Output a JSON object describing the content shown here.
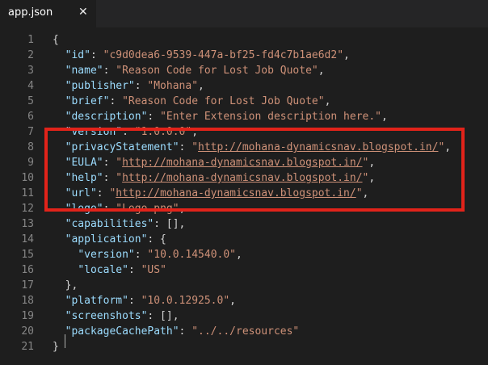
{
  "tab": {
    "title": "app.json",
    "close_glyph": "✕"
  },
  "lines": [
    {
      "n": "1",
      "parts": [
        [
          "p",
          "{"
        ]
      ]
    },
    {
      "n": "2",
      "parts": [
        [
          "p",
          "  "
        ],
        [
          "k",
          "\"id\""
        ],
        [
          "p",
          ": "
        ],
        [
          "s",
          "\"c9d0dea6-9539-447a-bf25-fd4c7b1ae6d2\""
        ],
        [
          "p",
          ","
        ]
      ]
    },
    {
      "n": "3",
      "parts": [
        [
          "p",
          "  "
        ],
        [
          "k",
          "\"name\""
        ],
        [
          "p",
          ": "
        ],
        [
          "s",
          "\"Reason Code for Lost Job Quote\""
        ],
        [
          "p",
          ","
        ]
      ]
    },
    {
      "n": "4",
      "parts": [
        [
          "p",
          "  "
        ],
        [
          "k",
          "\"publisher\""
        ],
        [
          "p",
          ": "
        ],
        [
          "s",
          "\"Mohana\""
        ],
        [
          "p",
          ","
        ]
      ]
    },
    {
      "n": "5",
      "parts": [
        [
          "p",
          "  "
        ],
        [
          "k",
          "\"brief\""
        ],
        [
          "p",
          ": "
        ],
        [
          "s",
          "\"Reason Code for Lost Job Quote\""
        ],
        [
          "p",
          ","
        ]
      ]
    },
    {
      "n": "6",
      "parts": [
        [
          "p",
          "  "
        ],
        [
          "k",
          "\"description\""
        ],
        [
          "p",
          ": "
        ],
        [
          "s",
          "\"Enter Extension description here.\""
        ],
        [
          "p",
          ","
        ]
      ]
    },
    {
      "n": "7",
      "parts": [
        [
          "p",
          "  "
        ],
        [
          "k",
          "\"version\""
        ],
        [
          "p",
          ": "
        ],
        [
          "s",
          "\"1.0.0.0\""
        ],
        [
          "p",
          ","
        ]
      ]
    },
    {
      "n": "8",
      "parts": [
        [
          "p",
          "  "
        ],
        [
          "k",
          "\"privacyStatement\""
        ],
        [
          "p",
          ": "
        ],
        [
          "s",
          "\""
        ],
        [
          "u",
          "http://mohana-dynamicsnav.blogspot.in/"
        ],
        [
          "s",
          "\""
        ],
        [
          "p",
          ","
        ]
      ]
    },
    {
      "n": "9",
      "parts": [
        [
          "p",
          "  "
        ],
        [
          "k",
          "\"EULA\""
        ],
        [
          "p",
          ": "
        ],
        [
          "s",
          "\""
        ],
        [
          "u",
          "http://mohana-dynamicsnav.blogspot.in/"
        ],
        [
          "s",
          "\""
        ],
        [
          "p",
          ","
        ]
      ]
    },
    {
      "n": "10",
      "parts": [
        [
          "p",
          "  "
        ],
        [
          "k",
          "\"help\""
        ],
        [
          "p",
          ": "
        ],
        [
          "s",
          "\""
        ],
        [
          "u",
          "http://mohana-dynamicsnav.blogspot.in/"
        ],
        [
          "s",
          "\""
        ],
        [
          "p",
          ","
        ]
      ]
    },
    {
      "n": "11",
      "parts": [
        [
          "p",
          "  "
        ],
        [
          "k",
          "\"url\""
        ],
        [
          "p",
          ": "
        ],
        [
          "s",
          "\""
        ],
        [
          "u",
          "http://mohana-dynamicsnav.blogspot.in/"
        ],
        [
          "s",
          "\""
        ],
        [
          "p",
          ","
        ]
      ]
    },
    {
      "n": "12",
      "parts": [
        [
          "p",
          "  "
        ],
        [
          "k",
          "\"logo\""
        ],
        [
          "p",
          ": "
        ],
        [
          "s",
          "\"Logo.png\""
        ],
        [
          "p",
          ","
        ]
      ]
    },
    {
      "n": "13",
      "parts": [
        [
          "p",
          "  "
        ],
        [
          "k",
          "\"capabilities\""
        ],
        [
          "p",
          ": [],"
        ]
      ]
    },
    {
      "n": "14",
      "parts": [
        [
          "p",
          "  "
        ],
        [
          "k",
          "\"application\""
        ],
        [
          "p",
          ": {"
        ]
      ]
    },
    {
      "n": "15",
      "parts": [
        [
          "p",
          "    "
        ],
        [
          "k",
          "\"version\""
        ],
        [
          "p",
          ": "
        ],
        [
          "s",
          "\"10.0.14540.0\""
        ],
        [
          "p",
          ","
        ]
      ]
    },
    {
      "n": "16",
      "parts": [
        [
          "p",
          "    "
        ],
        [
          "k",
          "\"locale\""
        ],
        [
          "p",
          ": "
        ],
        [
          "s",
          "\"US\""
        ]
      ]
    },
    {
      "n": "17",
      "parts": [
        [
          "p",
          "  },"
        ]
      ]
    },
    {
      "n": "18",
      "parts": [
        [
          "p",
          "  "
        ],
        [
          "k",
          "\"platform\""
        ],
        [
          "p",
          ": "
        ],
        [
          "s",
          "\"10.0.12925.0\""
        ],
        [
          "p",
          ","
        ]
      ]
    },
    {
      "n": "19",
      "parts": [
        [
          "p",
          "  "
        ],
        [
          "k",
          "\"screenshots\""
        ],
        [
          "p",
          ": [],"
        ]
      ]
    },
    {
      "n": "20",
      "parts": [
        [
          "p",
          "  "
        ],
        [
          "k",
          "\"packageCachePath\""
        ],
        [
          "p",
          ": "
        ],
        [
          "s",
          "\"../../resources\""
        ]
      ]
    },
    {
      "n": "21",
      "parts": [
        [
          "p",
          "}"
        ]
      ]
    }
  ],
  "colors": {
    "key": "#9cdcfe",
    "string": "#ce9178",
    "punctuation": "#d4d4d4",
    "line_number": "#858585",
    "highlight_border": "#e2231a",
    "background": "#1e1e1e"
  }
}
